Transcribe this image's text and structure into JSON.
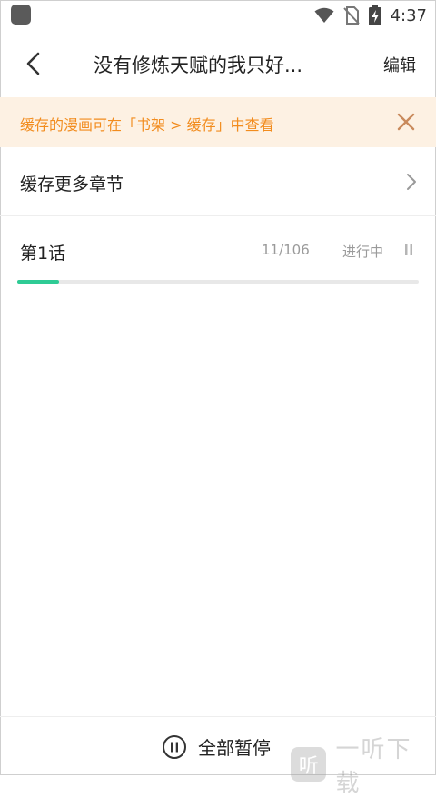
{
  "status_bar": {
    "time": "4:37"
  },
  "header": {
    "title": "没有修炼天赋的我只好...",
    "edit_label": "编辑"
  },
  "notice": {
    "text": "缓存的漫画可在「书架 > 缓存」中查看"
  },
  "more_chapters": {
    "label": "缓存更多章节"
  },
  "chapters": [
    {
      "name": "第1话",
      "count": "11/106",
      "state": "进行中",
      "progress": 0.104
    }
  ],
  "bottom": {
    "pause_all_label": "全部暂停"
  },
  "watermark": {
    "icon_text": "听",
    "text": "一听下载"
  },
  "colors": {
    "accent": "#2ecb95",
    "notice_text": "#f28c1e",
    "notice_bg": "#fdf1e3",
    "close_icon": "#c98a5c"
  }
}
